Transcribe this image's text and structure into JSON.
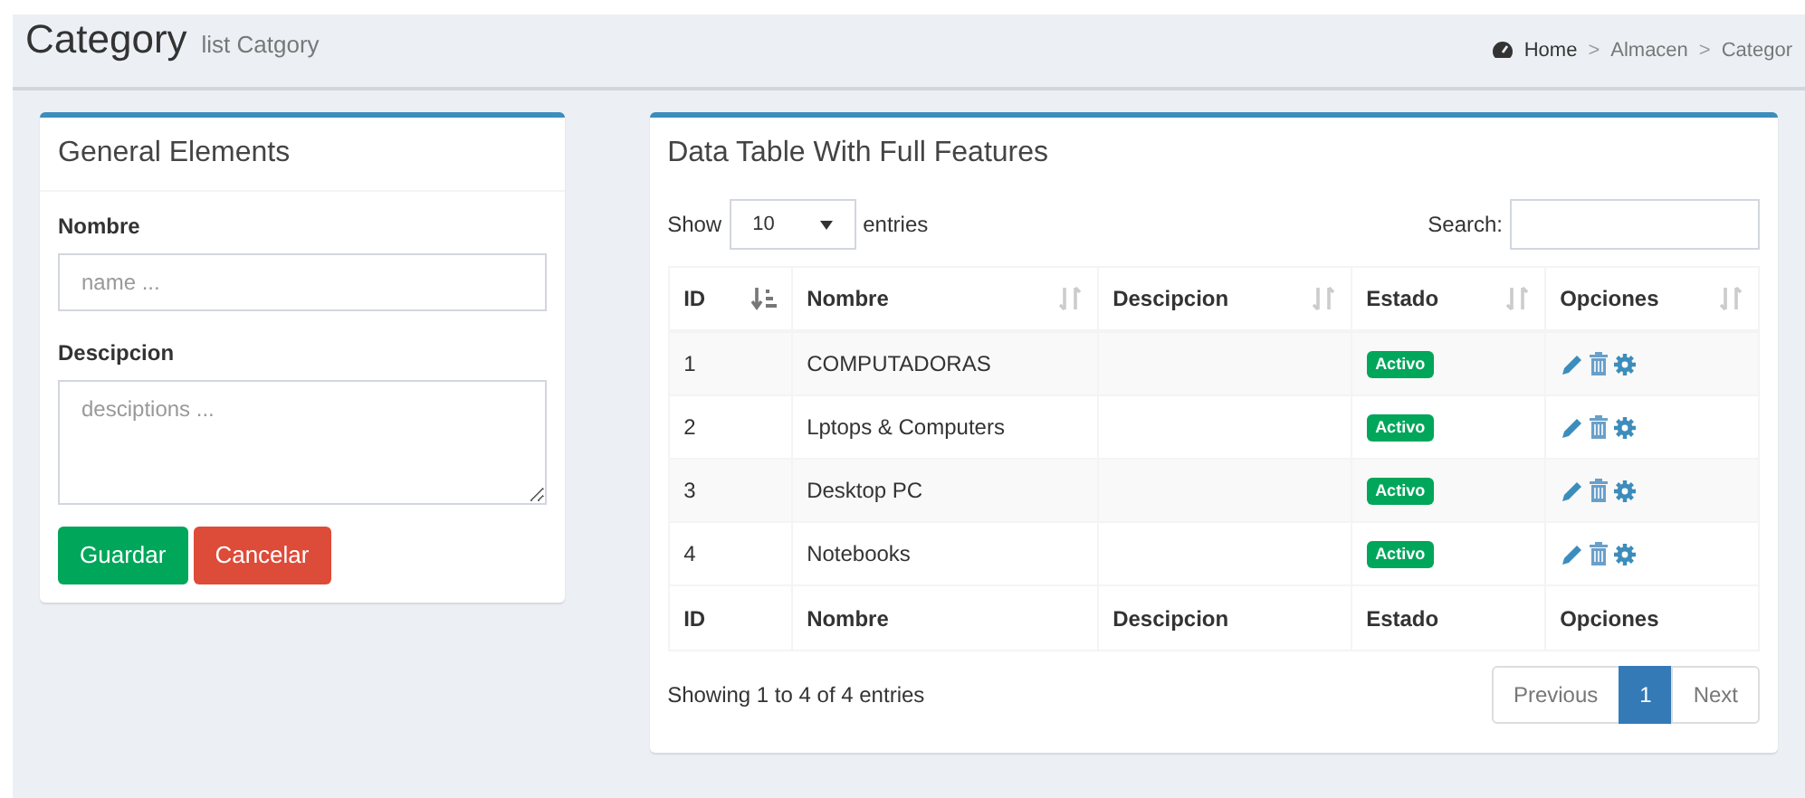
{
  "header": {
    "title": "Category",
    "subtitle": "list Catgory",
    "breadcrumb": [
      "Home",
      "Almacen",
      "Categor"
    ],
    "separator": ">"
  },
  "form": {
    "title": "General Elements",
    "fields": [
      {
        "kind": "input",
        "label": "Nombre",
        "placeholder": "name ..."
      },
      {
        "kind": "textarea",
        "label": "Descipcion",
        "placeholder": "desciptions ..."
      }
    ],
    "buttons": [
      {
        "label": "Guardar",
        "kind": "primary"
      },
      {
        "label": "Cancelar",
        "kind": "danger"
      }
    ]
  },
  "table_box": {
    "title": "Data Table With Full Features",
    "show_label": "Show",
    "page_size": "10",
    "entries_label": "entries",
    "search_label": "Search:",
    "columns": [
      {
        "label": "ID",
        "sorted": true
      },
      {
        "label": "Nombre",
        "sorted": false
      },
      {
        "label": "Descipcion",
        "sorted": false
      },
      {
        "label": "Estado",
        "sorted": false
      },
      {
        "label": "Opciones",
        "sorted": false
      }
    ],
    "rows": [
      {
        "id": "1",
        "nombre": "COMPUTADORAS",
        "estado": "Activo"
      },
      {
        "id": "2",
        "nombre": "Lptops & Computers",
        "estado": "Activo"
      },
      {
        "id": "3",
        "nombre": "Desktop PC",
        "estado": "Activo"
      },
      {
        "id": "4",
        "nombre": "Notebooks",
        "estado": "Activo"
      }
    ],
    "footer_columns": [
      "ID",
      "Nombre",
      "Descipcion",
      "Estado",
      "Opciones"
    ],
    "info": "Showing 1 to 4 of 4 entries",
    "pagination": [
      {
        "label": "Previous",
        "selected": false,
        "disabled": true
      },
      {
        "label": "1",
        "selected": true,
        "disabled": false
      },
      {
        "label": "Next",
        "selected": false,
        "disabled": true
      }
    ]
  }
}
